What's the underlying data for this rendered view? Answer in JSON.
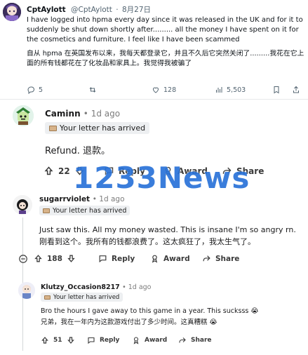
{
  "tweet": {
    "display_name": "CptAylott",
    "handle": "@CptAylott",
    "date": "8月27日",
    "body_en": "I have logged into hpma every day since it was released in the UK and for it to suddenly be shut down shortly after......... all the money I have spent on it for the cosmetics and furniture. I feel like I have been scammed",
    "body_zh": "自从 hpma 在英国发布以来，我每天都登录它，并且不久后它突然关闭了.........我花在它上面的所有钱都花在了化妆品和家具上。我觉得我被骗了",
    "replies": "5",
    "likes": "128",
    "views": "5,503"
  },
  "comments": [
    {
      "username": "Caminn",
      "age": "1d ago",
      "flair": "Your letter has arrived",
      "text_en": "Refund. 退款。",
      "votes": "22",
      "reply_label": "Reply",
      "award_label": "Award",
      "share_label": "Share"
    },
    {
      "username": "sugarrviolet",
      "age": "1d ago",
      "flair": "Your letter has arrived",
      "text_en": "Just saw this. All my money wasted. This is insane I'm so angry rn.",
      "text_zh": "刚看到这个。我所有的钱都浪费了。这太疯狂了，我太生气了。",
      "votes": "188",
      "reply_label": "Reply",
      "award_label": "Award",
      "share_label": "Share"
    },
    {
      "username": "Klutzy_Occasion8217",
      "age": "1d ago",
      "flair": "Your letter has arrived",
      "text_en": "Bro the hours I gave away to this game in a year. This sucksss 😭",
      "text_zh": "兄弟，我在一年内为这款游戏付出了多少时间。这真糟糕 😭",
      "votes": "51",
      "reply_label": "Reply",
      "award_label": "Award",
      "share_label": "Share"
    }
  ],
  "watermark": "1233News",
  "colors": {
    "tweet_secondary": "#536471",
    "reddit_action": "#3a3a3a",
    "flair_bg": "#edeff1",
    "watermark": "#2a73d8"
  }
}
